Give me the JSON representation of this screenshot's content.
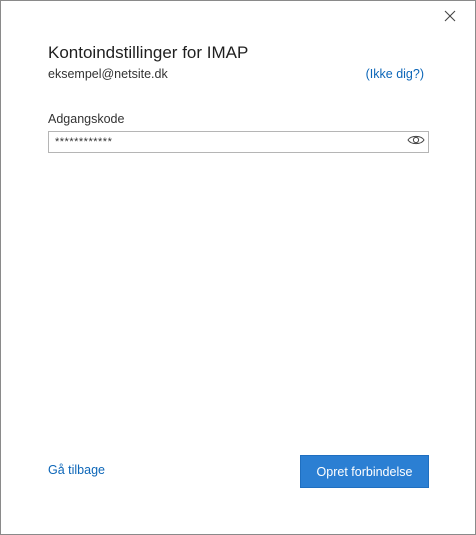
{
  "dialog": {
    "title": "Kontoindstillinger for IMAP",
    "account_email": "eksempel@netsite.dk",
    "not_you_link": "(Ikke dig?)",
    "password": {
      "label": "Adgangskode",
      "masked_value": "************",
      "reveal_icon": "eye-icon"
    },
    "close_icon": "close-icon",
    "back_link": "Gå tilbage",
    "connect_button": "Opret forbindelse"
  },
  "colors": {
    "link": "#0c66b8",
    "primary_button": "#2b7fd3",
    "border": "#8a8a8a"
  }
}
